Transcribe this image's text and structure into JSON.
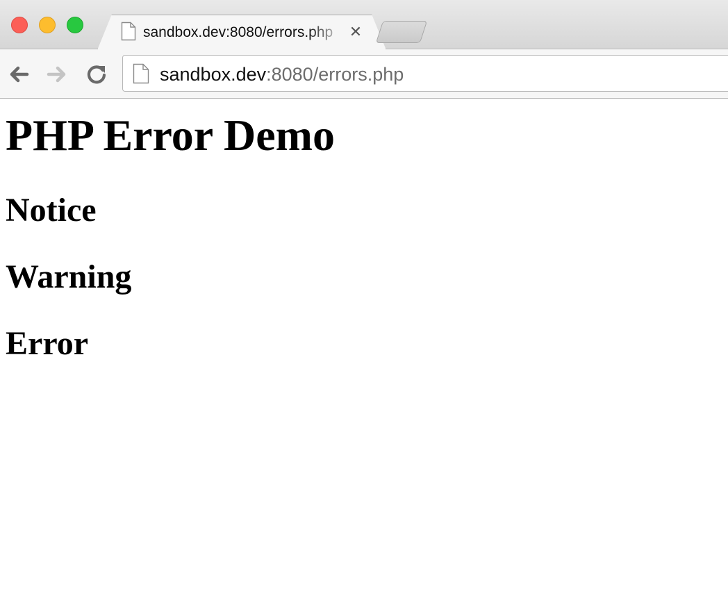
{
  "browser": {
    "tab": {
      "title": "sandbox.dev:8080/errors.php",
      "close_glyph": "✕",
      "icon": "page-icon"
    },
    "address_bar": {
      "host": "sandbox.dev",
      "rest": ":8080/errors.php",
      "icon": "page-icon"
    },
    "nav_icons": [
      "back-arrow-icon",
      "forward-arrow-icon",
      "reload-icon"
    ],
    "traffic_light_colors": {
      "close": "#fc5f57",
      "minimize": "#fdbd2e",
      "zoom": "#28c840"
    }
  },
  "page": {
    "title": "PHP Error Demo",
    "sections": [
      "Notice",
      "Warning",
      "Error"
    ]
  }
}
